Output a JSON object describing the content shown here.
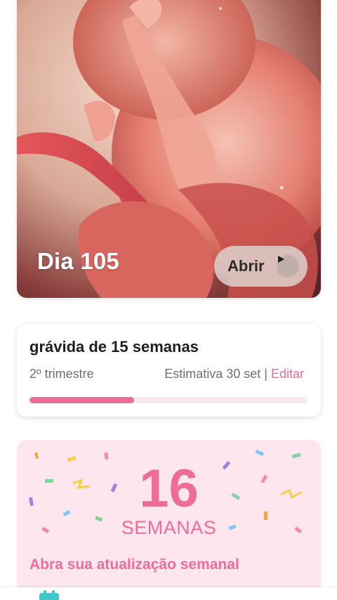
{
  "hero": {
    "day_label": "Dia 105",
    "open_button_label": "Abrir",
    "image": "fetus-illustration"
  },
  "pregnancy": {
    "title": "grávida de 15 semanas",
    "trimester": "2º trimestre",
    "estimate_label": "Estimativa 30 set |",
    "edit_label": "Editar",
    "progress_fraction": 0.375
  },
  "weekly_update": {
    "week_number": "16",
    "week_unit": "SEMANAS",
    "cta": "Abra sua atualização semanal"
  },
  "bottom_nav": {
    "icon": "calendar-icon"
  },
  "colors": {
    "accent": "#ee6d96",
    "weekly_bg": "#fde6ee",
    "progress_track": "#fde7ee",
    "nav_icon": "#3fc7c8"
  }
}
